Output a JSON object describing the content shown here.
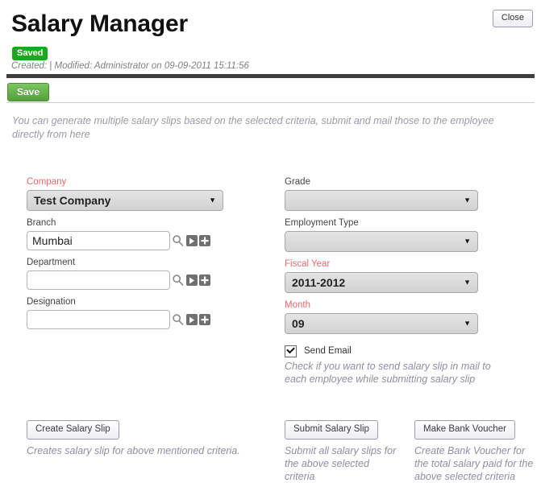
{
  "header": {
    "title": "Salary Manager",
    "close_label": "Close",
    "status_badge": "Saved",
    "meta": "Created: | Modified: Administrator on 09-09-2011 15:11:56",
    "save_label": "Save",
    "accent_saved": "#1ba81b",
    "accent_required": "#e8696e"
  },
  "intro": "You can generate multiple salary slips based on the selected criteria, submit and mail those to the employee directly from here",
  "form": {
    "left": [
      {
        "label": "Company",
        "required": true,
        "type": "select",
        "value": "Test Company",
        "arrow": "▼"
      },
      {
        "label": "Branch",
        "required": false,
        "type": "link",
        "value": "Mumbai",
        "placeholder": "",
        "icons": [
          "search-icon",
          "go-icon",
          "add-icon"
        ]
      },
      {
        "label": "Department",
        "required": false,
        "type": "link",
        "value": "",
        "placeholder": "",
        "icons": [
          "search-icon",
          "go-icon",
          "add-icon"
        ]
      },
      {
        "label": "Designation",
        "required": false,
        "type": "link",
        "value": "",
        "placeholder": "",
        "icons": [
          "search-icon",
          "go-icon",
          "add-icon"
        ]
      }
    ],
    "right": [
      {
        "label": "Grade",
        "required": false,
        "type": "select",
        "value": "",
        "arrow": "▼"
      },
      {
        "label": "Employment Type",
        "required": false,
        "type": "select",
        "value": "",
        "arrow": "▼"
      },
      {
        "label": "Fiscal Year",
        "required": true,
        "type": "select",
        "value": "2011-2012",
        "arrow": "▼"
      },
      {
        "label": "Month",
        "required": true,
        "type": "select",
        "value": "09",
        "arrow": "▼"
      }
    ],
    "send_email": {
      "label": "Send Email",
      "checked": true,
      "hint": "Check if you want to send salary slip in mail to each employee while submitting salary slip"
    }
  },
  "actions": [
    {
      "label": "Create Salary Slip",
      "hint": "Creates salary slip for above mentioned criteria."
    },
    {
      "label": "Submit Salary Slip",
      "hint": "Submit all salary slips for the above selected criteria"
    },
    {
      "label": "Make Bank Voucher",
      "hint": "Create Bank Voucher for the total salary paid for the above selected criteria"
    }
  ]
}
